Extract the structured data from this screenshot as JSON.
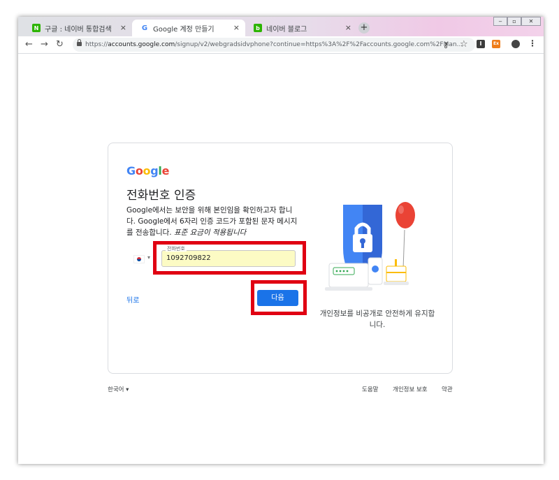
{
  "browser": {
    "tabs": [
      {
        "label": "구글 : 네이버 통합검색",
        "icon": "naver-icon",
        "icon_text": "N"
      },
      {
        "label": "Google 계정 만들기",
        "icon": "google-icon",
        "icon_text": "G"
      },
      {
        "label": "네이버 블로그",
        "icon": "naver-blog-icon",
        "icon_text": "b"
      }
    ],
    "tab_close": "×",
    "new_tab": "+",
    "url_prefix": "https://",
    "url_host": "accounts.google.com",
    "url_path": "/signup/v2/webgradsidvphone?continue=https%3A%2F%2Faccounts.google.com%2FMan...",
    "extensions": [
      "I",
      "Ex"
    ]
  },
  "card": {
    "logo": [
      "G",
      "o",
      "o",
      "g",
      "l",
      "e"
    ],
    "heading": "전화번호 인증",
    "description": "Google에서는 보안을 위해 본인임을 확인하고자 합니다. Google에서 6자리 인증 코드가 포함된 문자 메시지를 전송합니다.",
    "description_italic": "표준 요금이 적용됩니다",
    "phone_label": "전화번호",
    "phone_value": "1092709822",
    "back_label": "뒤로",
    "next_label": "다음",
    "caption": "개인정보를 비공개로 안전하게 유지합니다."
  },
  "footer": {
    "language": "한국어",
    "links": [
      "도움말",
      "개인정보 보호",
      "약관"
    ]
  },
  "colors": {
    "google_blue": "#4285f4",
    "google_red": "#ea4335",
    "google_yellow": "#fbbc05",
    "google_green": "#34a853",
    "button": "#1a73e8",
    "highlight": "#e00012"
  }
}
